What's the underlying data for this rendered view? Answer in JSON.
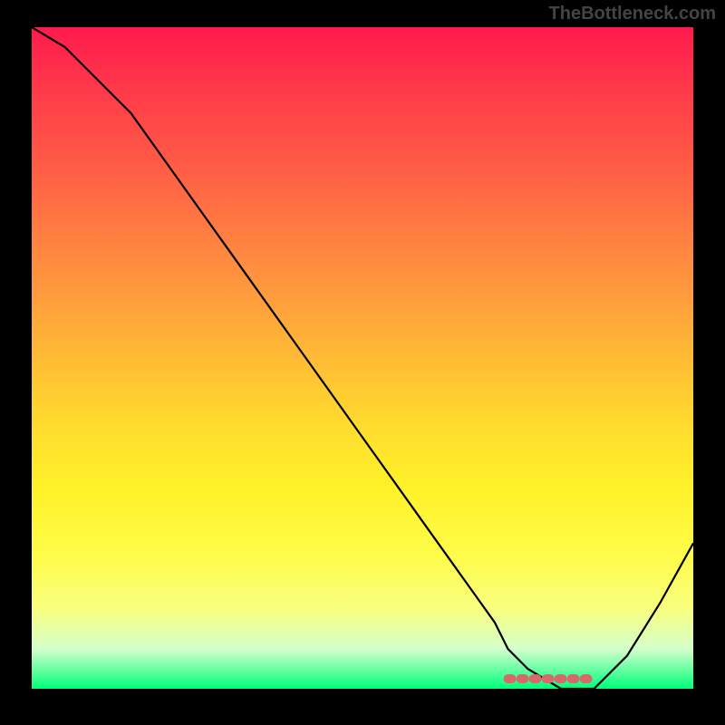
{
  "watermark": "TheBottleneck.com",
  "chart_data": {
    "type": "line",
    "title": "",
    "xlabel": "",
    "ylabel": "",
    "xlim": [
      0,
      100
    ],
    "ylim": [
      0,
      100
    ],
    "series": [
      {
        "name": "curve",
        "x": [
          0,
          5,
          10,
          15,
          20,
          25,
          30,
          35,
          40,
          45,
          50,
          55,
          60,
          65,
          70,
          72,
          75,
          80,
          82,
          85,
          90,
          95,
          100
        ],
        "values": [
          100,
          97,
          92,
          87,
          80,
          73,
          66,
          59,
          52,
          45,
          38,
          31,
          24,
          17,
          10,
          6,
          3,
          0,
          0,
          0,
          5,
          13,
          22
        ]
      }
    ],
    "flat_region": {
      "x_start": 72,
      "x_end": 85,
      "y": 1.5,
      "color": "#d66a6a"
    }
  }
}
